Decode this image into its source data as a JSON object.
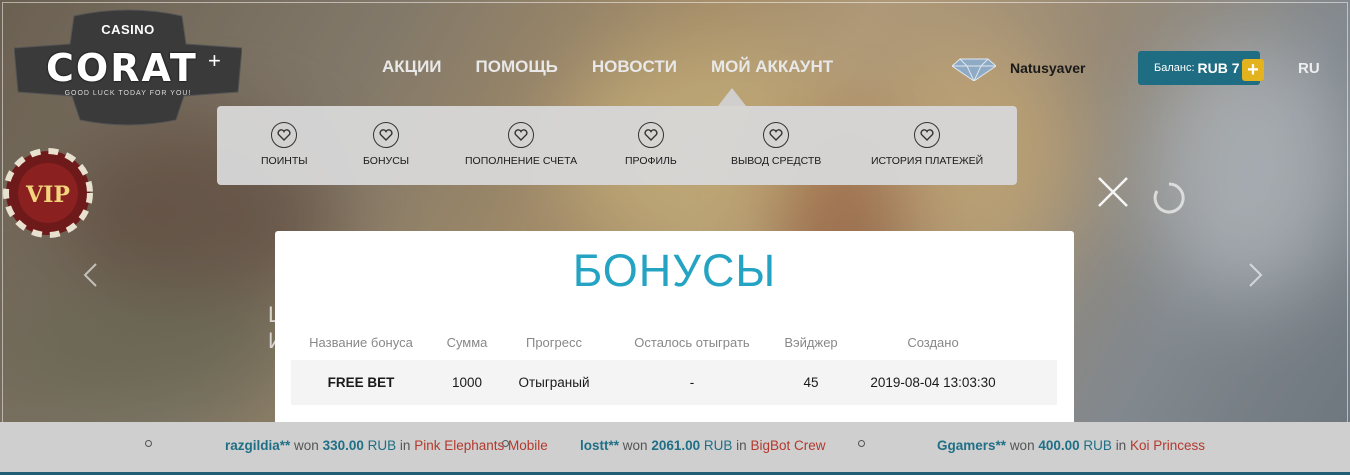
{
  "logo": {
    "casino": "CASINO",
    "brand": "CORAT",
    "plus": "+",
    "tagline": "GOOD LUCK TODAY FOR YOU!",
    "vip": "VIP"
  },
  "nav": [
    "АКЦИИ",
    "ПОМОЩЬ",
    "НОВОСТИ",
    "МОЙ АККАУНТ"
  ],
  "user": {
    "username": "Natusyaver",
    "avatar_icon": "diamond-icon"
  },
  "balance": {
    "label": "Баланс:",
    "amount": "RUB 7",
    "plus": "+"
  },
  "language": "RU",
  "account_menu": [
    {
      "label": "ПОИНТЫ",
      "icon": "heart-icon"
    },
    {
      "label": "БОНУСЫ",
      "icon": "heart-icon"
    },
    {
      "label": "ПОПОЛНЕНИЕ СЧЕТА",
      "icon": "heart-icon"
    },
    {
      "label": "ПРОФИЛЬ",
      "icon": "heart-icon"
    },
    {
      "label": "ВЫВОД СРЕДСТВ",
      "icon": "heart-icon"
    },
    {
      "label": "ИСТОРИЯ ПЛАТЕЖЕЙ",
      "icon": "heart-icon"
    }
  ],
  "modal": {
    "title": "БОНУСЫ",
    "columns": [
      "Название бонуса",
      "Сумма",
      "Прогресс",
      "Осталось отыграть",
      "Вэйджер",
      "Создано"
    ],
    "rows": [
      [
        "FREE BET",
        "1000",
        "Отыграный",
        "-",
        "45",
        "2019-08-04 13:03:30"
      ]
    ]
  },
  "hero_text": [
    "L",
    "И"
  ],
  "ticker": [
    {
      "name": "razgildia**",
      "won": "won",
      "amount": "330.00",
      "currency": "RUB",
      "in": "in",
      "game": "Pink Elephants Mobile"
    },
    {
      "name": "lostt**",
      "won": "won",
      "amount": "2061.00",
      "currency": "RUB",
      "in": "in",
      "game": "BigBot Crew"
    },
    {
      "name": "Ggamers**",
      "won": "won",
      "amount": "400.00",
      "currency": "RUB",
      "in": "in",
      "game": "Koi Princess"
    }
  ],
  "colors": {
    "accent": "#24a4c2",
    "balance_bg": "#1e6d83",
    "plus_btn": "#e3b21f",
    "ticker_name": "#1f6f86",
    "ticker_game": "#b3392d"
  }
}
